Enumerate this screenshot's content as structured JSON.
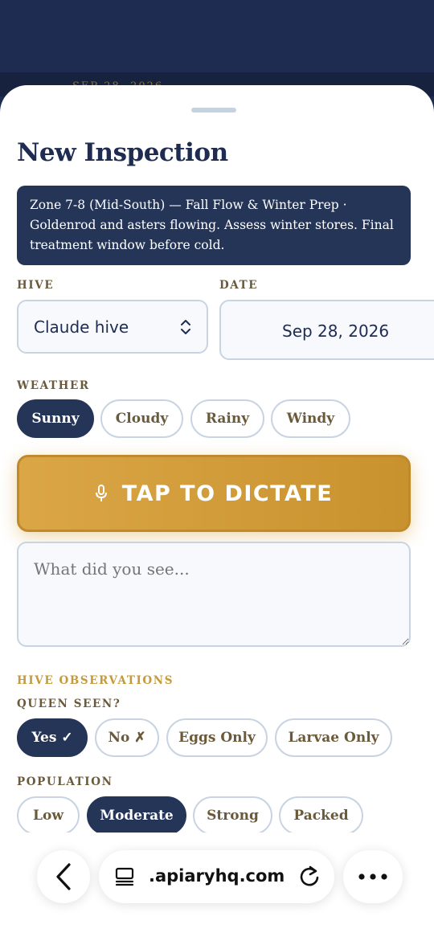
{
  "background": {
    "date_peek": "SEP 28, 2026"
  },
  "sheet": {
    "title": "New Inspection",
    "banner": "Zone 7-8 (Mid-South) — Fall Flow & Winter Prep · Goldenrod and asters flowing. Assess winter stores. Final treatment window before cold.",
    "hive_label": "HIVE",
    "hive_value": "Claude hive",
    "date_label": "DATE",
    "date_value": "Sep 28, 2026",
    "weather_label": "WEATHER",
    "weather_options": [
      "Sunny",
      "Cloudy",
      "Rainy",
      "Windy"
    ],
    "weather_selected": "Sunny",
    "dictate_label": "TAP TO DICTATE",
    "notes_placeholder": "What did you see...",
    "observations_label": "HIVE OBSERVATIONS",
    "queen_label": "QUEEN SEEN?",
    "queen_options": [
      "Yes ✓",
      "No ✗",
      "Eggs Only",
      "Larvae Only"
    ],
    "queen_selected": "Yes ✓",
    "population_label": "POPULATION",
    "population_options": [
      "Low",
      "Moderate",
      "Strong",
      "Packed"
    ],
    "population_selected": "Moderate"
  },
  "browser": {
    "url": ".apiaryhq.com",
    "icons": [
      "back-icon",
      "tabs-icon",
      "reload-icon",
      "more-icon"
    ]
  },
  "colors": {
    "navy": "#1e2c52",
    "gold": "#c8922e",
    "border": "#c8d4e2"
  }
}
